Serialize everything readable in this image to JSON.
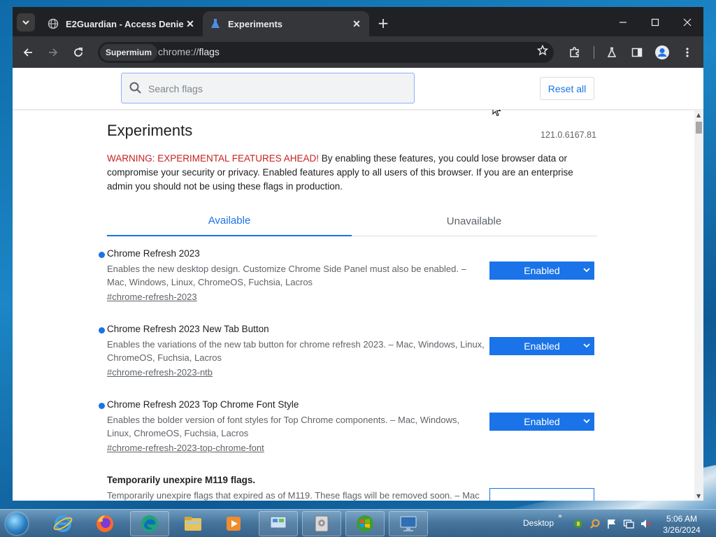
{
  "browser": {
    "tab_search_icon": "chevron-down-icon",
    "tabs": [
      {
        "title": "E2Guardian - Access Denied",
        "icon": "globe-icon",
        "active": false
      },
      {
        "title": "Experiments",
        "icon": "flask-icon",
        "active": true
      }
    ],
    "new_tab_glyph": "+",
    "window_controls": {
      "minimize": "—",
      "maximize": "☐",
      "close": "✕"
    },
    "toolbar": {
      "profile_chip": "Supermium",
      "url_scheme": "chrome://",
      "url_path": "flags"
    }
  },
  "flags_page": {
    "search_placeholder": "Search flags",
    "reset_label": "Reset all",
    "title": "Experiments",
    "version": "121.0.6167.81",
    "warning_strong": "WARNING: EXPERIMENTAL FEATURES AHEAD!",
    "warning_rest": " By enabling these features, you could lose browser data or compromise your security or privacy. Enabled features apply to all users of this browser. If you are an enterprise admin you should not be using these flags in production.",
    "tabs": {
      "available": "Available",
      "unavailable": "Unavailable"
    },
    "flags": [
      {
        "name": "Chrome Refresh 2023",
        "description": "Enables the new desktop design. Customize Chrome Side Panel must also be enabled. – Mac, Windows, Linux, ChromeOS, Fuchsia, Lacros",
        "anchor": "#chrome-refresh-2023",
        "state": "Enabled",
        "modified": true
      },
      {
        "name": "Chrome Refresh 2023 New Tab Button",
        "description": "Enables the variations of the new tab button for chrome refresh 2023. – Mac, Windows, Linux, ChromeOS, Fuchsia, Lacros",
        "anchor": "#chrome-refresh-2023-ntb",
        "state": "Enabled",
        "modified": true
      },
      {
        "name": "Chrome Refresh 2023 Top Chrome Font Style",
        "description": "Enables the bolder version of font styles for Top Chrome components. – Mac, Windows, Linux, ChromeOS, Fuchsia, Lacros",
        "anchor": "#chrome-refresh-2023-top-chrome-font",
        "state": "Enabled",
        "modified": true
      },
      {
        "name": "Temporarily unexpire M119 flags.",
        "description": "Temporarily unexpire flags that expired as of M119. These flags will be removed soon. – Mac",
        "anchor": "",
        "state": "",
        "modified": false
      }
    ]
  },
  "taskbar": {
    "apps": [
      "internet-explorer-icon",
      "firefox-icon",
      "edge-icon",
      "file-explorer-icon",
      "media-player-icon",
      "control-panel-icon",
      "disk-utility-icon",
      "windows-update-icon",
      "remote-desktop-icon"
    ],
    "desktop_label": "Desktop",
    "tray_chevron": "»",
    "time": "5:06 AM",
    "date": "3/26/2024"
  },
  "colors": {
    "accent": "#1a73e8",
    "warning": "#c5221f",
    "browser_dark": "#202124"
  }
}
